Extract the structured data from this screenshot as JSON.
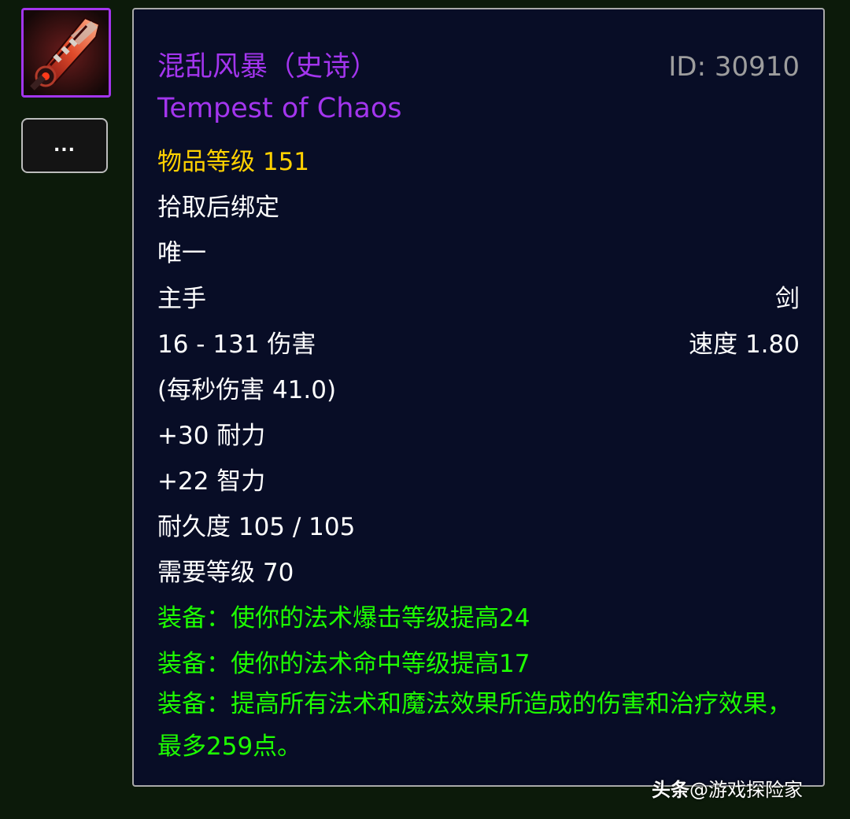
{
  "item": {
    "name": "混乱风暴（史诗）",
    "id_text": "ID: 30910",
    "english_name": "Tempest of Chaos",
    "item_level": "物品等级 151",
    "binding": "拾取后绑定",
    "unique": "唯一",
    "slot": "主手",
    "weapon_type": "剑",
    "damage": "16 - 131 伤害",
    "speed": "速度 1.80",
    "dps": "(每秒伤害 41.0)",
    "stamina": "+30 耐力",
    "intellect": "+22 智力",
    "durability": "耐久度 105 / 105",
    "required_level": "需要等级 70",
    "effects": [
      "装备：使你的法术爆击等级提高24",
      "装备：使你的法术命中等级提高17",
      "装备：提高所有法术和魔法效果所造成的伤害和治疗效果，最多259点。"
    ]
  },
  "more_button": {
    "label": "..."
  },
  "icon": {
    "name": "sword-icon"
  },
  "watermark": {
    "brand": "头条",
    "handle": "@游戏探险家"
  },
  "colors": {
    "epic": "#a335ee",
    "item_level": "#ffd100",
    "equip_effect": "#1eff00",
    "id": "#9d9d9d",
    "tooltip_bg": "#080d26",
    "page_bg": "#0c1a0a"
  }
}
